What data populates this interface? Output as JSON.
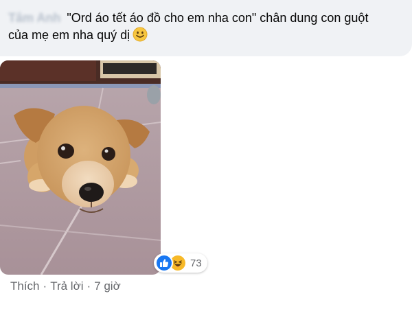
{
  "comment": {
    "author": "Tâm Anh",
    "line1": "\"Ord áo tết áo đồ cho em nha con\" chân dung con guột",
    "line2": "của mẹ em nha quý dị",
    "emoji_icon": "slightly-smiling-face-icon"
  },
  "photo": {
    "subject": "puppy-photo"
  },
  "reactions": {
    "icons": [
      "like-icon",
      "haha-icon"
    ],
    "count": "73",
    "like_color": "#1877f2",
    "haha_color": "#f7b928"
  },
  "actions": {
    "like_label": "Thích",
    "reply_label": "Trả lời",
    "separator": "·",
    "time": "7 giờ"
  },
  "colors": {
    "bubble_bg": "#f0f2f5",
    "text": "#050505",
    "meta_text": "#65676b"
  }
}
